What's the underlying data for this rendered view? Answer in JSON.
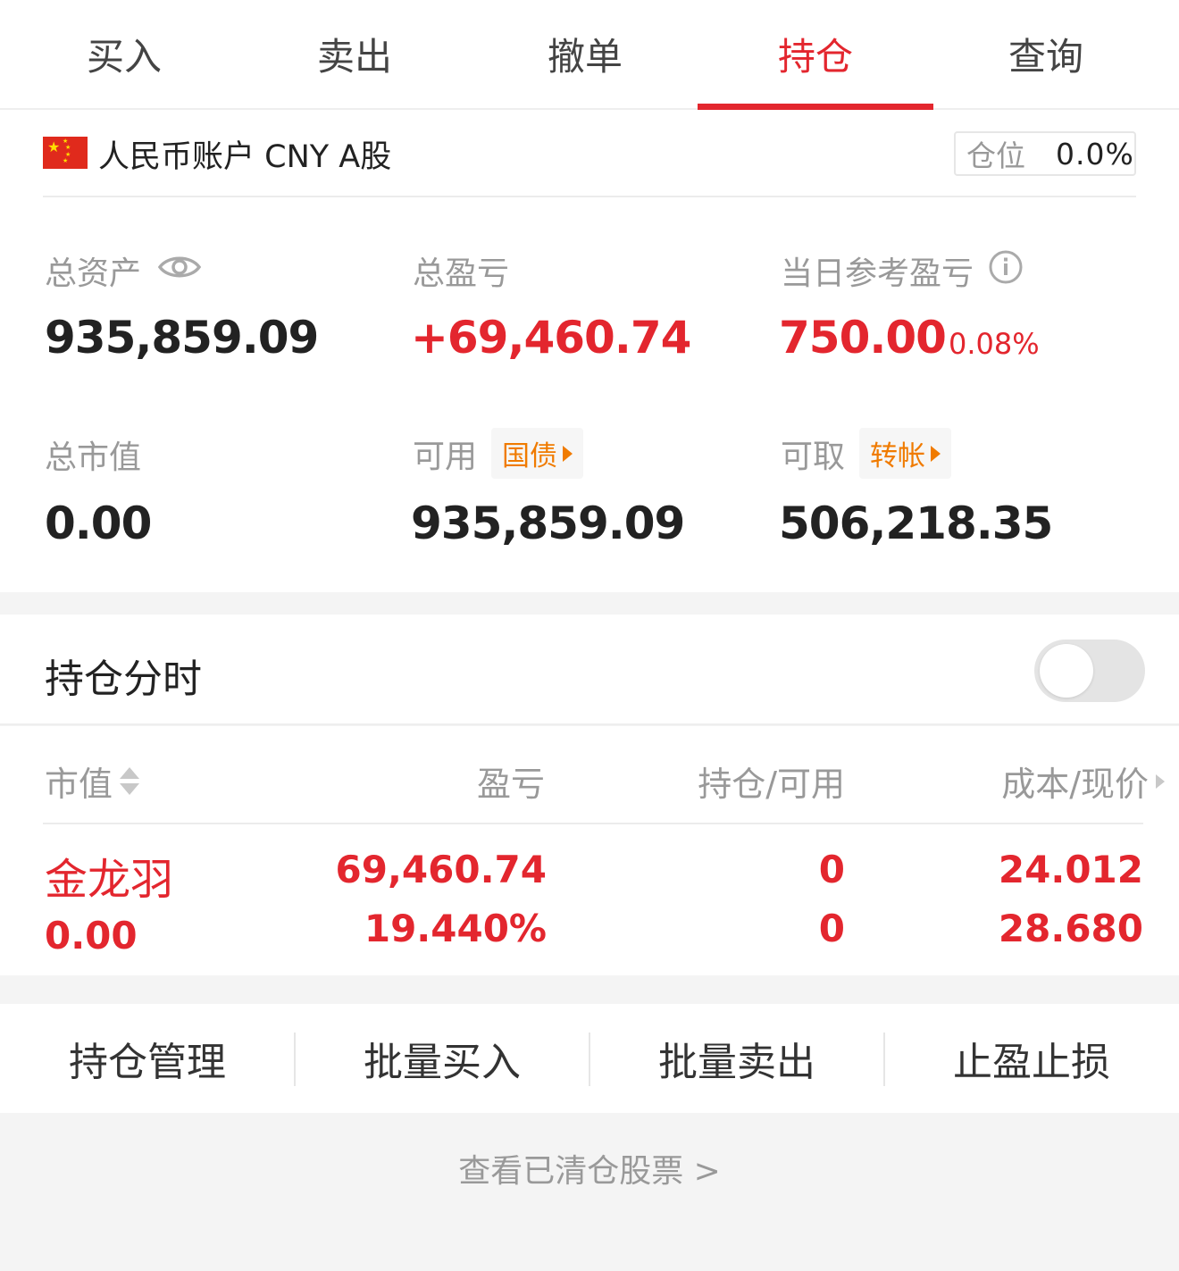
{
  "tabs": [
    {
      "label": "买入"
    },
    {
      "label": "卖出"
    },
    {
      "label": "撤单"
    },
    {
      "label": "持仓",
      "active": true
    },
    {
      "label": "查询"
    }
  ],
  "account": {
    "flag_icon": "china-flag-icon",
    "name": "人民币账户 CNY A股",
    "position_label": "仓位",
    "position_value": "0.0%"
  },
  "summary": {
    "total_assets": {
      "label": "总资产",
      "value": "935,859.09",
      "icon": "eye-icon"
    },
    "total_pnl": {
      "label": "总盈亏",
      "value": "+69,460.74"
    },
    "daily_pnl": {
      "label": "当日参考盈亏",
      "value": "750.00",
      "percent": "0.08%",
      "icon": "info-icon"
    },
    "market_value": {
      "label": "总市值",
      "value": "0.00"
    },
    "available": {
      "label": "可用",
      "chip": "国债",
      "value": "935,859.09"
    },
    "withdrawable": {
      "label": "可取",
      "chip": "转帐",
      "value": "506,218.35"
    }
  },
  "intraday": {
    "label": "持仓分时",
    "enabled": false
  },
  "table": {
    "headers": {
      "market_value": "市值",
      "pnl": "盈亏",
      "holding": "持仓/可用",
      "cost_price": "成本/现价"
    },
    "rows": [
      {
        "name": "金龙羽",
        "market_value": "0.00",
        "pnl": "69,460.74",
        "pnl_pct": "19.440%",
        "holding": "0",
        "available": "0",
        "cost": "24.012",
        "price": "28.680"
      }
    ]
  },
  "actions": [
    {
      "label": "持仓管理"
    },
    {
      "label": "批量买入"
    },
    {
      "label": "批量卖出"
    },
    {
      "label": "止盈止损"
    }
  ],
  "cleared_link": "查看已清仓股票 >",
  "colors": {
    "accent": "#e3262e",
    "chip": "#f07b00",
    "muted": "#999999"
  }
}
